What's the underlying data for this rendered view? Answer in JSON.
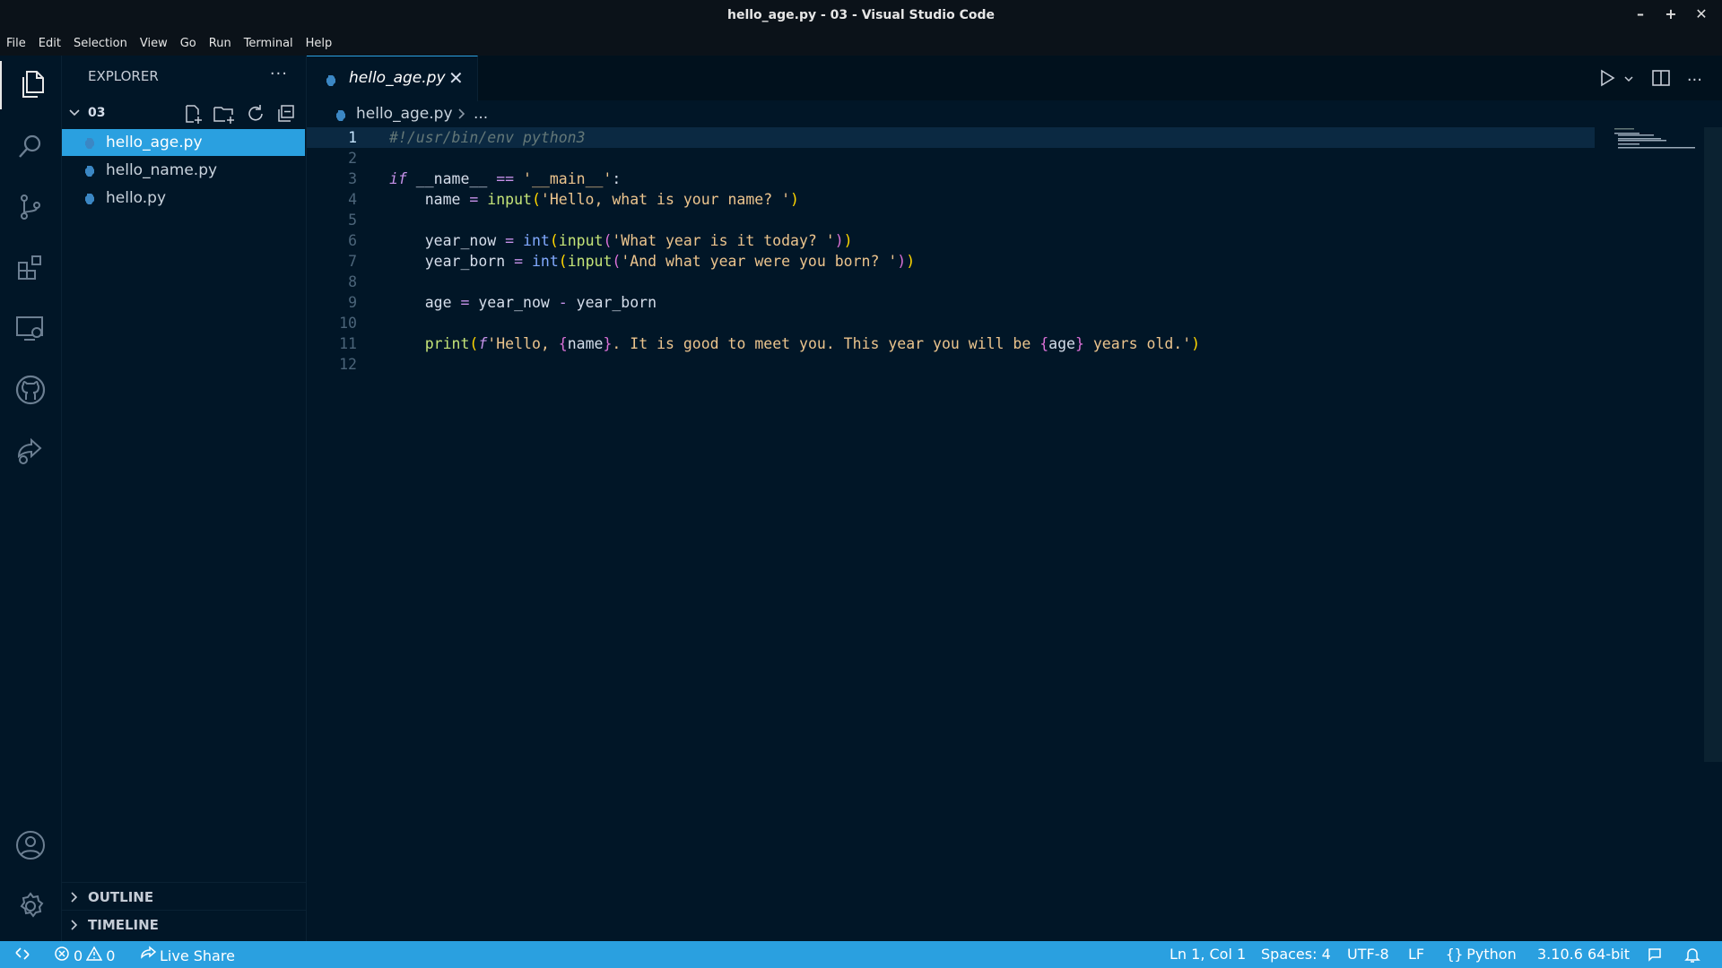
{
  "window": {
    "title": "hello_age.py - 03 - Visual Studio Code"
  },
  "menu": [
    "File",
    "Edit",
    "Selection",
    "View",
    "Go",
    "Run",
    "Terminal",
    "Help"
  ],
  "explorer": {
    "header": "EXPLORER",
    "folder": "03",
    "files": [
      {
        "name": "hello_age.py",
        "selected": true
      },
      {
        "name": "hello_name.py",
        "selected": false
      },
      {
        "name": "hello.py",
        "selected": false
      }
    ],
    "sections": [
      "OUTLINE",
      "TIMELINE"
    ]
  },
  "tab": {
    "label": "hello_age.py"
  },
  "breadcrumb": {
    "file": "hello_age.py",
    "more": "..."
  },
  "code": {
    "line_numbers": [
      "1",
      "2",
      "3",
      "4",
      "5",
      "6",
      "7",
      "8",
      "9",
      "10",
      "11",
      "12"
    ],
    "lines": [
      {
        "tokens": [
          {
            "t": "#!/usr/bin/env python3",
            "c": "comment"
          }
        ]
      },
      {
        "tokens": []
      },
      {
        "tokens": [
          {
            "t": "if",
            "c": "kw"
          },
          {
            "t": " __name__ ",
            "c": "var"
          },
          {
            "t": "==",
            "c": "op"
          },
          {
            "t": " '__main__'",
            "c": "str"
          },
          {
            "t": ":",
            "c": "var"
          }
        ]
      },
      {
        "tokens": [
          {
            "t": "    name ",
            "c": "var"
          },
          {
            "t": "=",
            "c": "op"
          },
          {
            "t": " ",
            "c": "var"
          },
          {
            "t": "input",
            "c": "fnc"
          },
          {
            "t": "(",
            "c": "br"
          },
          {
            "t": "'Hello, what is your name? '",
            "c": "str"
          },
          {
            "t": ")",
            "c": "br"
          }
        ]
      },
      {
        "tokens": []
      },
      {
        "tokens": [
          {
            "t": "    year_now ",
            "c": "var"
          },
          {
            "t": "=",
            "c": "op"
          },
          {
            "t": " ",
            "c": "var"
          },
          {
            "t": "int",
            "c": "fn"
          },
          {
            "t": "(",
            "c": "br"
          },
          {
            "t": "input",
            "c": "fnc"
          },
          {
            "t": "(",
            "c": "br2"
          },
          {
            "t": "'What year is it today? '",
            "c": "str"
          },
          {
            "t": ")",
            "c": "br2"
          },
          {
            "t": ")",
            "c": "br"
          }
        ]
      },
      {
        "tokens": [
          {
            "t": "    year_born ",
            "c": "var"
          },
          {
            "t": "=",
            "c": "op"
          },
          {
            "t": " ",
            "c": "var"
          },
          {
            "t": "int",
            "c": "fn"
          },
          {
            "t": "(",
            "c": "br"
          },
          {
            "t": "input",
            "c": "fnc"
          },
          {
            "t": "(",
            "c": "br2"
          },
          {
            "t": "'And what year were you born? '",
            "c": "str"
          },
          {
            "t": ")",
            "c": "br2"
          },
          {
            "t": ")",
            "c": "br"
          }
        ]
      },
      {
        "tokens": []
      },
      {
        "tokens": [
          {
            "t": "    age ",
            "c": "var"
          },
          {
            "t": "=",
            "c": "op"
          },
          {
            "t": " year_now ",
            "c": "var"
          },
          {
            "t": "-",
            "c": "op"
          },
          {
            "t": " year_born",
            "c": "var"
          }
        ]
      },
      {
        "tokens": []
      },
      {
        "tokens": [
          {
            "t": "    ",
            "c": "var"
          },
          {
            "t": "print",
            "c": "fnc"
          },
          {
            "t": "(",
            "c": "br"
          },
          {
            "t": "f",
            "c": "f"
          },
          {
            "t": "'Hello, ",
            "c": "str"
          },
          {
            "t": "{",
            "c": "br2"
          },
          {
            "t": "name",
            "c": "var"
          },
          {
            "t": "}",
            "c": "br2"
          },
          {
            "t": ". It is good to meet you. This year you will be ",
            "c": "str"
          },
          {
            "t": "{",
            "c": "br2"
          },
          {
            "t": "age",
            "c": "var"
          },
          {
            "t": "}",
            "c": "br2"
          },
          {
            "t": " years old.'",
            "c": "str"
          },
          {
            "t": ")",
            "c": "br"
          }
        ]
      },
      {
        "tokens": []
      }
    ]
  },
  "status": {
    "errors": "0",
    "warnings": "0",
    "live_share": "Live Share",
    "position": "Ln 1, Col 1",
    "spaces": "Spaces: 4",
    "encoding": "UTF-8",
    "eol": "LF",
    "language": "Python",
    "interpreter": "3.10.6 64-bit"
  },
  "colors": {
    "accent": "#2aa0e0",
    "background": "#011627",
    "selection": "#0b2942"
  }
}
